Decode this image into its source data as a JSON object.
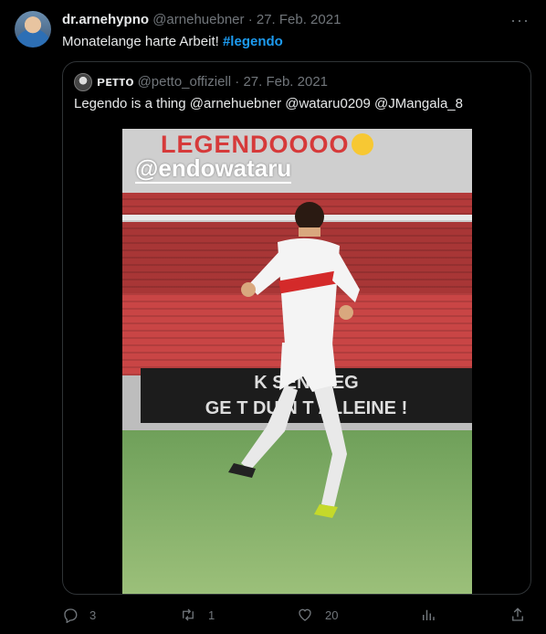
{
  "tweet": {
    "display_name": "dr.arnehypno",
    "handle": "@arnehuebner",
    "date": "27. Feb. 2021",
    "text": "Monatelange harte Arbeit!",
    "hashtag": "#legendo",
    "more_icon": "more-icon"
  },
  "quote": {
    "display_name": "ᴘᴇᴛᴛᴏ",
    "handle": "@petto_offiziell",
    "date": "27. Feb. 2021",
    "text": "Legendo is a thing @arnehuebner @wataru0209 @JMangala_8",
    "media": {
      "overlay_title": "LEGENDOOOO",
      "overlay_handle": "@endowataru",
      "banner_line1": "K      SEN WEG",
      "banner_line2": "GE   T DU N     T ALLEINE !"
    }
  },
  "actions": {
    "reply_count": "3",
    "retweet_count": "1",
    "like_count": "20"
  },
  "colors": {
    "background": "#000000",
    "text": "#e7e9ea",
    "muted": "#71767b",
    "accent": "#1d9bf0",
    "border": "#2f3336"
  }
}
